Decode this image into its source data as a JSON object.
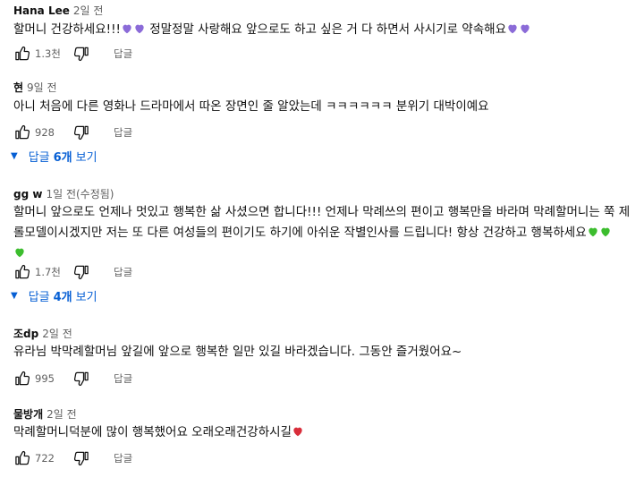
{
  "labels": {
    "reply": "답글"
  },
  "colors": {
    "purple_heart": "#8b6bd8",
    "green_heart": "#3cbd2e",
    "red_heart": "#d92d3a",
    "link_blue": "#065fd4"
  },
  "comments": [
    {
      "author": "Hana Lee",
      "meta": "2일 전",
      "text_parts": [
        "할머니 건강하세요!!!",
        "정말정말 사랑해요 앞으로도 하고 싶은 거 다 하면서 사시기로 약속해요"
      ],
      "likes": "1.3천"
    },
    {
      "author": "현",
      "meta": "9일 전",
      "text": "아니 처음에 다른 영화나 드라마에서 따온 장면인 줄 알았는데 ㅋㅋㅋㅋㅋㅋ 분위기 대박이예요",
      "likes": "928",
      "replies": {
        "pre": "답글",
        "count": "6개",
        "post": "보기"
      }
    },
    {
      "author": "gg w",
      "meta": "1일 전(수정됨)",
      "text_line1": "할머니 앞으로도 언제나 멋있고 행복한 삶 사셨으면 합니다!!! 언제나 막례쓰의 편이고 행복만을 바라며 막례할머니는 쭉 제",
      "text_line2": "롤모델이시겠지만 저는 또 다른 여성들의 편이기도 하기에 아쉬운 작별인사를 드립니다! 항상 건강하고 행복하세요",
      "likes": "1.7천",
      "replies": {
        "pre": "답글",
        "count": "4개",
        "post": "보기"
      }
    },
    {
      "author": "조dp",
      "meta": "2일 전",
      "text": "유라님 박막례할머님 앞길에 앞으로 행복한 일만 있길 바라겠습니다. 그동안 즐거웠어요~",
      "likes": "995"
    },
    {
      "author": "물방개",
      "meta": "2일 전",
      "text": "막례할머니덕분에 많이 행복했어요 오래오래건강하시길",
      "likes": "722"
    }
  ]
}
